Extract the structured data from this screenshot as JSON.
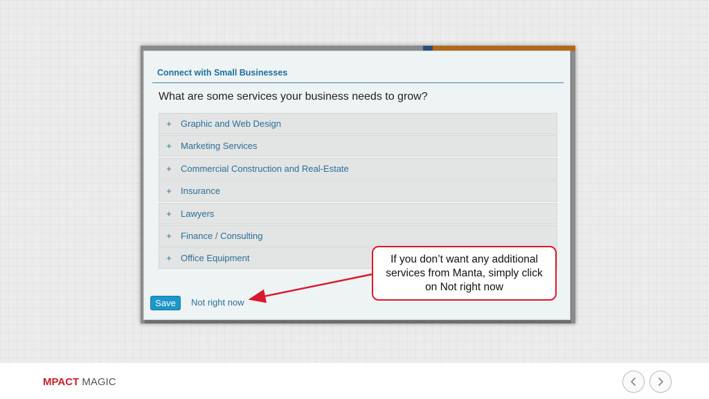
{
  "modal": {
    "title": "Connect with Small Businesses",
    "question": "What are some services your business needs to grow?",
    "services": [
      {
        "icon": "+",
        "label": "Graphic and Web Design"
      },
      {
        "icon": "+",
        "label": "Marketing Services"
      },
      {
        "icon": "+",
        "label": "Commercial Construction and Real-Estate"
      },
      {
        "icon": "+",
        "label": "Insurance"
      },
      {
        "icon": "+",
        "label": "Lawyers"
      },
      {
        "icon": "+",
        "label": "Finance / Consulting"
      },
      {
        "icon": "+",
        "label": "Office Equipment"
      }
    ],
    "save_label": "Save",
    "not_now_label": "Not right now"
  },
  "callout": {
    "text": "If you don’t want any additional services from Manta, simply click on Not right now"
  },
  "footer": {
    "brand_main": "MPACT",
    "brand_sub": "MAGIC",
    "prev_icon": "chevron-left-icon",
    "next_icon": "chevron-right-icon"
  },
  "colors": {
    "accent": "#1c97c8",
    "link": "#2a6f98",
    "callout_border": "#d9182b",
    "brand": "#c8202b"
  }
}
